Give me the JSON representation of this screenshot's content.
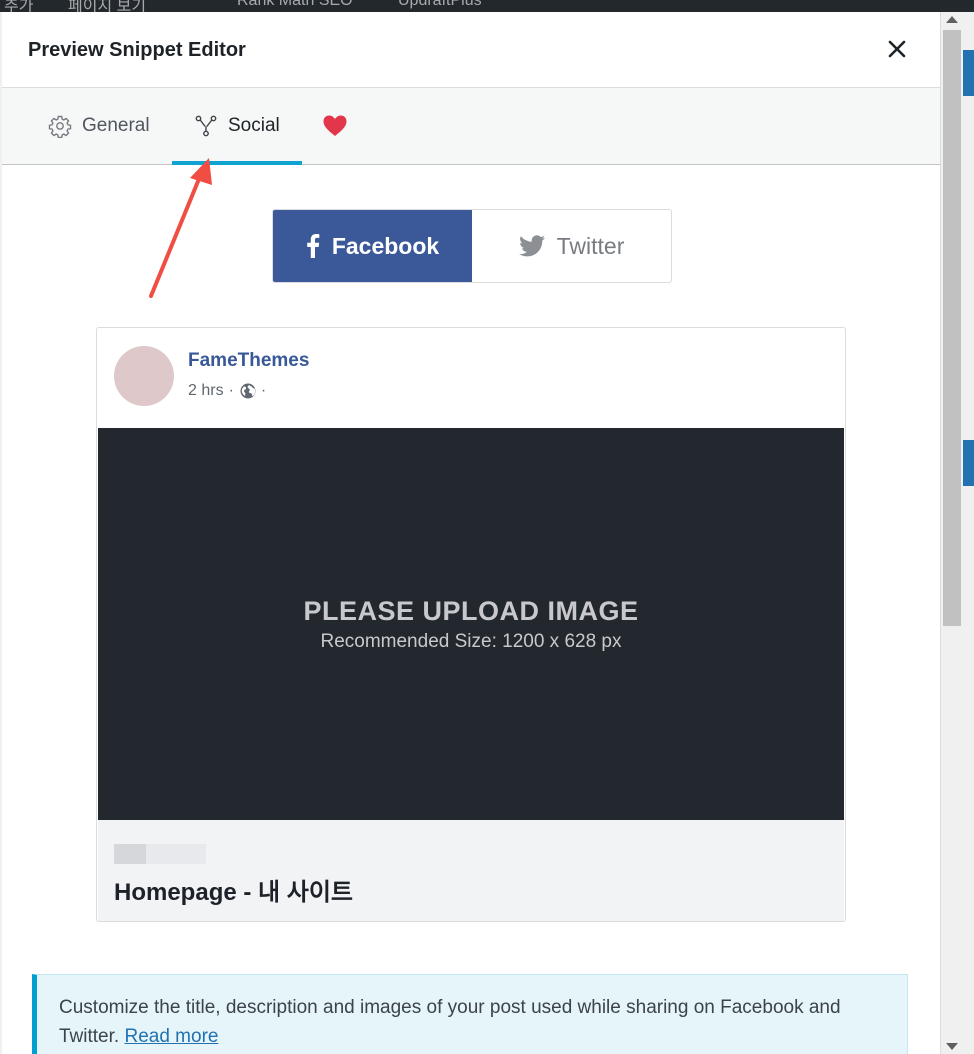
{
  "admin_bar": {
    "items": [
      "추가",
      "페이지 보기",
      "Rank Math SEO",
      "UpdraftPlus"
    ]
  },
  "modal": {
    "title": "Preview Snippet Editor",
    "close_icon": "close-icon"
  },
  "tabs": [
    {
      "label": "General",
      "icon": "gear-icon"
    },
    {
      "label": "Social",
      "icon": "share-nodes-icon",
      "active": true
    },
    {
      "label": "",
      "icon": "heart-icon"
    }
  ],
  "social_switch": {
    "facebook_label": "Facebook",
    "twitter_label": "Twitter",
    "selected": "Facebook"
  },
  "facebook_preview": {
    "page_name": "FameThemes",
    "time": "2 hrs",
    "separator": "·",
    "image_placeholder_title": "PLEASE UPLOAD IMAGE",
    "image_placeholder_subtitle": "Recommended Size: 1200 x 628 px",
    "post_title": "Homepage - 내 사이트"
  },
  "notice": {
    "text": "Customize the title, description and images of your post used while sharing on Facebook and Twitter. ",
    "link_text": "Read more"
  },
  "colors": {
    "facebook_blue": "#3b5998",
    "tab_active": "#10a2d1",
    "heart": "#e2364a",
    "annotation_arrow": "#f04e42",
    "image_bg": "#23272e",
    "notice_bg": "#e5f5fa"
  }
}
